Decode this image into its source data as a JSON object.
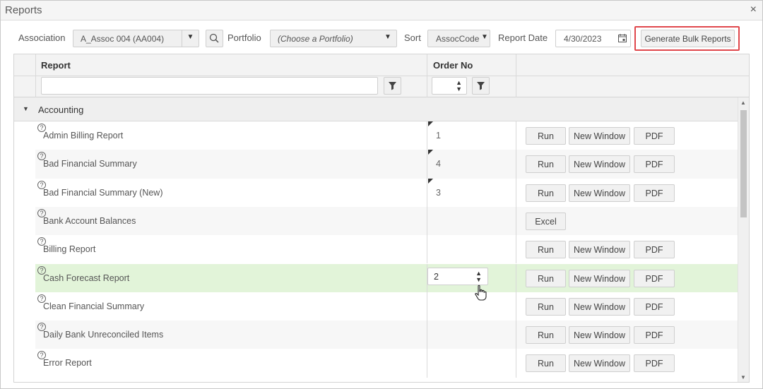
{
  "window": {
    "title": "Reports",
    "close_glyph": "×"
  },
  "toolbar": {
    "association_label": "Association",
    "association_value": "A_Assoc 004 (AA004)",
    "portfolio_label": "Portfolio",
    "portfolio_value": "(Choose a Portfolio)",
    "sort_label": "Sort",
    "sort_value": "AssocCode",
    "report_date_label": "Report Date",
    "report_date_value": "4/30/2023",
    "bulk_button_label": "Generate Bulk Reports",
    "highlight_color": "#e0474c"
  },
  "grid": {
    "columns": {
      "report": "Report",
      "order_no": "Order No"
    },
    "group": {
      "label": "Accounting"
    },
    "rows": [
      {
        "name": "Admin Billing Report",
        "order": "1",
        "buttons": [
          "Run",
          "New Window",
          "PDF"
        ]
      },
      {
        "name": "Bad Financial Summary",
        "order": "4",
        "buttons": [
          "Run",
          "New Window",
          "PDF"
        ]
      },
      {
        "name": "Bad Financial Summary (New)",
        "order": "3",
        "buttons": [
          "Run",
          "New Window",
          "PDF"
        ]
      },
      {
        "name": "Bank Account Balances",
        "order": "",
        "buttons": [
          "Excel"
        ]
      },
      {
        "name": "Billing Report",
        "order": "",
        "buttons": [
          "Run",
          "New Window",
          "PDF"
        ]
      },
      {
        "name": "Cash Forecast Report",
        "order": "2",
        "buttons": [
          "Run",
          "New Window",
          "PDF"
        ]
      },
      {
        "name": "Clean Financial Summary",
        "order": "",
        "buttons": [
          "Run",
          "New Window",
          "PDF"
        ]
      },
      {
        "name": "Daily Bank Unreconciled Items",
        "order": "",
        "buttons": [
          "Run",
          "New Window",
          "PDF"
        ]
      },
      {
        "name": "Error Report",
        "order": "",
        "buttons": [
          "Run",
          "New Window",
          "PDF"
        ]
      }
    ],
    "highlight_row_color": "#e2f4d9"
  }
}
